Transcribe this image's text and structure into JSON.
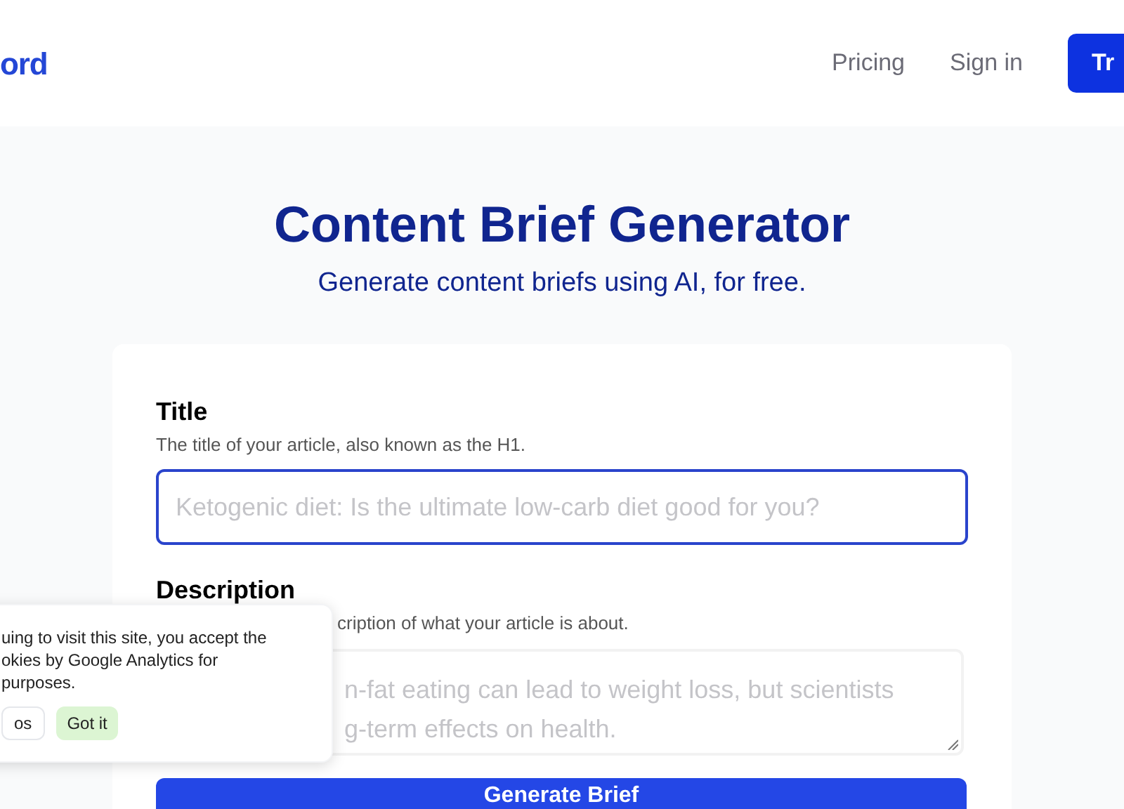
{
  "header": {
    "logo": "ord",
    "nav": [
      {
        "label": "Pricing"
      },
      {
        "label": "Sign in"
      }
    ],
    "cta": "Tr"
  },
  "hero": {
    "title": "Content Brief Generator",
    "subtitle": "Generate content briefs using AI, for free."
  },
  "form": {
    "fields": [
      {
        "kind": "input",
        "label": "Title",
        "hint": "The title of your article, also known as the H1.",
        "placeholder": "Ketogenic diet: Is the ultimate low-carb diet good for you?",
        "focused": true
      },
      {
        "kind": "textarea",
        "label": "Description",
        "hint": "cription of what your article is about.",
        "placeholder_lines": [
          "n-fat eating can lead to weight loss, but scientists",
          "g-term effects on health."
        ],
        "focused": false
      }
    ],
    "submit": "Generate Brief"
  },
  "cookie_notice": {
    "lines": [
      "uing to visit this site, you accept the",
      "okies by Google Analytics for",
      "purposes."
    ],
    "buttons": [
      {
        "label": "os",
        "kind": "secondary"
      },
      {
        "label": "Got it",
        "kind": "primary"
      }
    ]
  }
}
